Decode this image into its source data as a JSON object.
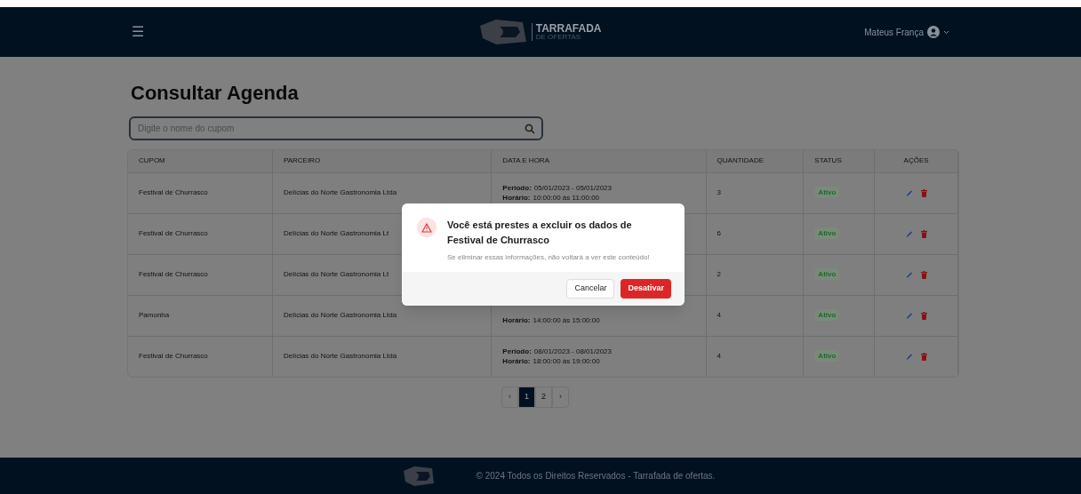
{
  "header": {
    "menu_icon": "☰",
    "brand": "TARRAFADA",
    "brand_sub": "DE OFERTAS",
    "user": "Mateus França"
  },
  "page_title": "Consultar Agenda",
  "search": {
    "placeholder": "Digite o nome do cupom"
  },
  "table": {
    "columns": [
      "CUPOM",
      "PARCEIRO",
      "DATA E HORA",
      "QUANTIDADE",
      "STATUS",
      "AÇÕES"
    ],
    "rows": [
      {
        "cupom": "Festival de Churrasco",
        "parceiro": "Delícias do Norte Gastronomia Ltda",
        "periodo_label": "Período:",
        "periodo": "05/01/2023 - 05/01/2023",
        "horario_label": "Horário:",
        "horario": "10:00:00 às 11:00:00",
        "quantidade": "3",
        "status": "Ativo"
      },
      {
        "cupom": "Festival de Churrasco",
        "parceiro": "Delícias do Norte Gastronomia Lt",
        "quantidade": "6",
        "status": "Ativo"
      },
      {
        "cupom": "Festival de Churrasco",
        "parceiro": "Delícias do Norte Gastronomia Lt",
        "quantidade": "2",
        "status": "Ativo"
      },
      {
        "cupom": "Pamonha",
        "parceiro": "Delícias do Norte Gastronomia Ltda",
        "horario_label": "Horário:",
        "horario": "14:00:00 às 15:00:00",
        "quantidade": "4",
        "status": "Ativo"
      },
      {
        "cupom": "Festival de Churrasco",
        "parceiro": "Delícias do Norte Gastronomia Ltda",
        "periodo_label": "Período:",
        "periodo": "08/01/2023 - 08/01/2023",
        "horario_label": "Horário:",
        "horario": "18:00:00 às 19:00:00",
        "quantidade": "4",
        "status": "Ativo"
      }
    ]
  },
  "pagination": {
    "prev": "‹",
    "pages": [
      {
        "label": "1",
        "selected": true
      },
      {
        "label": "2",
        "selected": false
      }
    ],
    "next": "›"
  },
  "modal": {
    "title": "Você está prestes a excluir os dados de Festival de Churrasco",
    "message": "Se eliminar essas informações, não voltará a ver este conteúdo!",
    "buttons": [
      {
        "label": "Cancelar",
        "kind": "secondary"
      },
      {
        "label": "Desativar",
        "kind": "danger"
      }
    ]
  },
  "footer": {
    "text": "© 2024 Todos os Direitos Reservados - Tarrafada de ofertas."
  }
}
